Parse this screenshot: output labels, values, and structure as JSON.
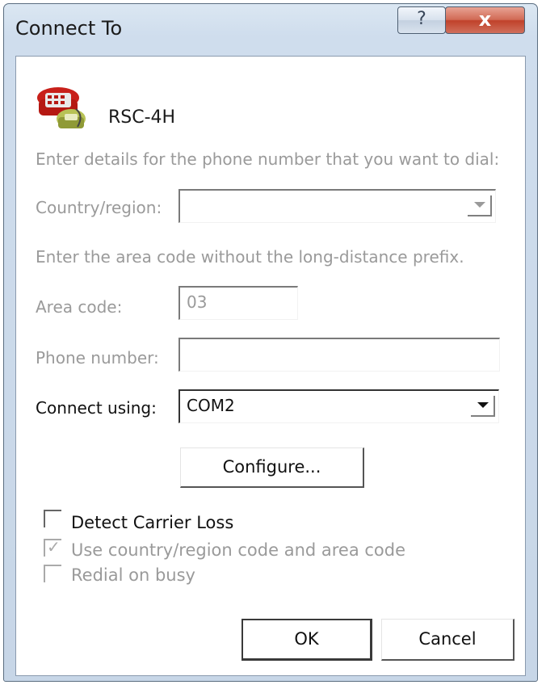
{
  "window": {
    "title": "Connect To",
    "help_glyph": "?",
    "close_glyph": "x"
  },
  "connection": {
    "name": "RSC-4H",
    "icon": "telephone-icon"
  },
  "instructions": {
    "phone_details": "Enter details for the phone number that you want to dial:",
    "area_code_hint": "Enter the area code without the long-distance prefix."
  },
  "fields": {
    "country_label": "Country/region:",
    "country_value": "",
    "area_code_label": "Area code:",
    "area_code_value": "03",
    "phone_label": "Phone number:",
    "phone_value": "",
    "connect_using_label": "Connect using:",
    "connect_using_value": "COM2"
  },
  "buttons": {
    "configure": "Configure...",
    "ok": "OK",
    "cancel": "Cancel"
  },
  "checkboxes": [
    {
      "label": "Detect Carrier Loss",
      "checked": false,
      "enabled": true
    },
    {
      "label": "Use country/region code and area code",
      "checked": true,
      "enabled": false
    },
    {
      "label": "Redial on busy",
      "checked": false,
      "enabled": false
    }
  ],
  "colors": {
    "disabled_text": "#9a9a9a",
    "close_button": "#c0412a",
    "frame": "#cfdded"
  }
}
